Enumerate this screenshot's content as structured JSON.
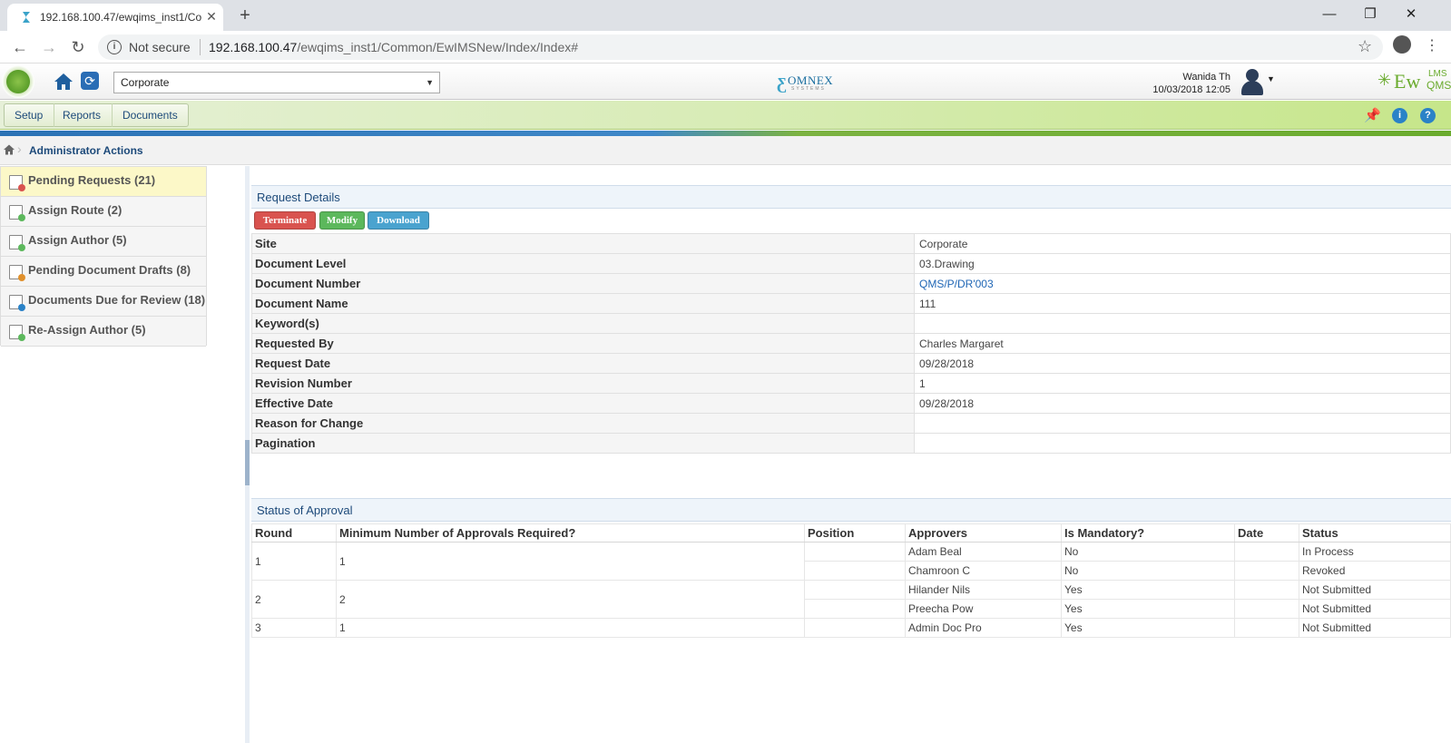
{
  "browser": {
    "tab_title": "192.168.100.47/ewqims_inst1/Co",
    "security_label": "Not secure",
    "url_host": "192.168.100.47",
    "url_path": "/ewqims_inst1/Common/EwIMSNew/Index/Index#"
  },
  "header": {
    "site_value": "Corporate",
    "omnex_logo": "OMNEX",
    "omnex_sub": "SYSTEMS",
    "user_name": "Wanida Th",
    "user_datetime": "10/03/2018 12:05",
    "product_logo_main": "Ew",
    "product_logo_top": "LMS",
    "product_logo_bottom": "QMS"
  },
  "menu": {
    "items": [
      "Setup",
      "Reports",
      "Documents"
    ]
  },
  "breadcrumb": {
    "current": "Administrator Actions"
  },
  "sidebar": {
    "items": [
      {
        "label": "Pending Requests (21)"
      },
      {
        "label": "Assign Route (2)"
      },
      {
        "label": "Assign Author (5)"
      },
      {
        "label": "Pending Document Drafts (8)"
      },
      {
        "label": "Documents Due for Review (18)"
      },
      {
        "label": "Re-Assign Author (5)"
      }
    ]
  },
  "request_details": {
    "title": "Request Details",
    "buttons": {
      "terminate": "Terminate",
      "modify": "Modify",
      "download": "Download"
    },
    "rows": [
      {
        "key": "Site",
        "value": "Corporate"
      },
      {
        "key": "Document Level",
        "value": "03.Drawing"
      },
      {
        "key": "Document Number",
        "value": "QMS/P/DR'003"
      },
      {
        "key": "Document Name",
        "value": "111"
      },
      {
        "key": "Keyword(s)",
        "value": ""
      },
      {
        "key": "Requested By",
        "value": "Charles Margaret"
      },
      {
        "key": "Request Date",
        "value": "09/28/2018"
      },
      {
        "key": "Revision Number",
        "value": "1"
      },
      {
        "key": "Effective Date",
        "value": "09/28/2018"
      },
      {
        "key": "Reason for Change",
        "value": ""
      },
      {
        "key": "Pagination",
        "value": ""
      }
    ]
  },
  "approval": {
    "title": "Status of Approval",
    "headers": [
      "Round",
      "Minimum Number of Approvals Required?",
      "Position",
      "Approvers",
      "Is Mandatory?",
      "Date",
      "Status"
    ],
    "rounds": [
      {
        "round": "1",
        "min": "1",
        "approvers": [
          {
            "name": "Adam Beal",
            "mandatory": "No",
            "status": "In Process"
          },
          {
            "name": "Chamroon C",
            "mandatory": "No",
            "status": "Revoked"
          }
        ]
      },
      {
        "round": "2",
        "min": "2",
        "approvers": [
          {
            "name": "Hilander Nils",
            "mandatory": "Yes",
            "status": "Not Submitted"
          },
          {
            "name": "Preecha Pow",
            "mandatory": "Yes",
            "status": "Not Submitted"
          }
        ]
      },
      {
        "round": "3",
        "min": "1",
        "approvers": [
          {
            "name": "Admin Doc Pro",
            "mandatory": "Yes",
            "status": "Not Submitted"
          }
        ]
      }
    ]
  }
}
